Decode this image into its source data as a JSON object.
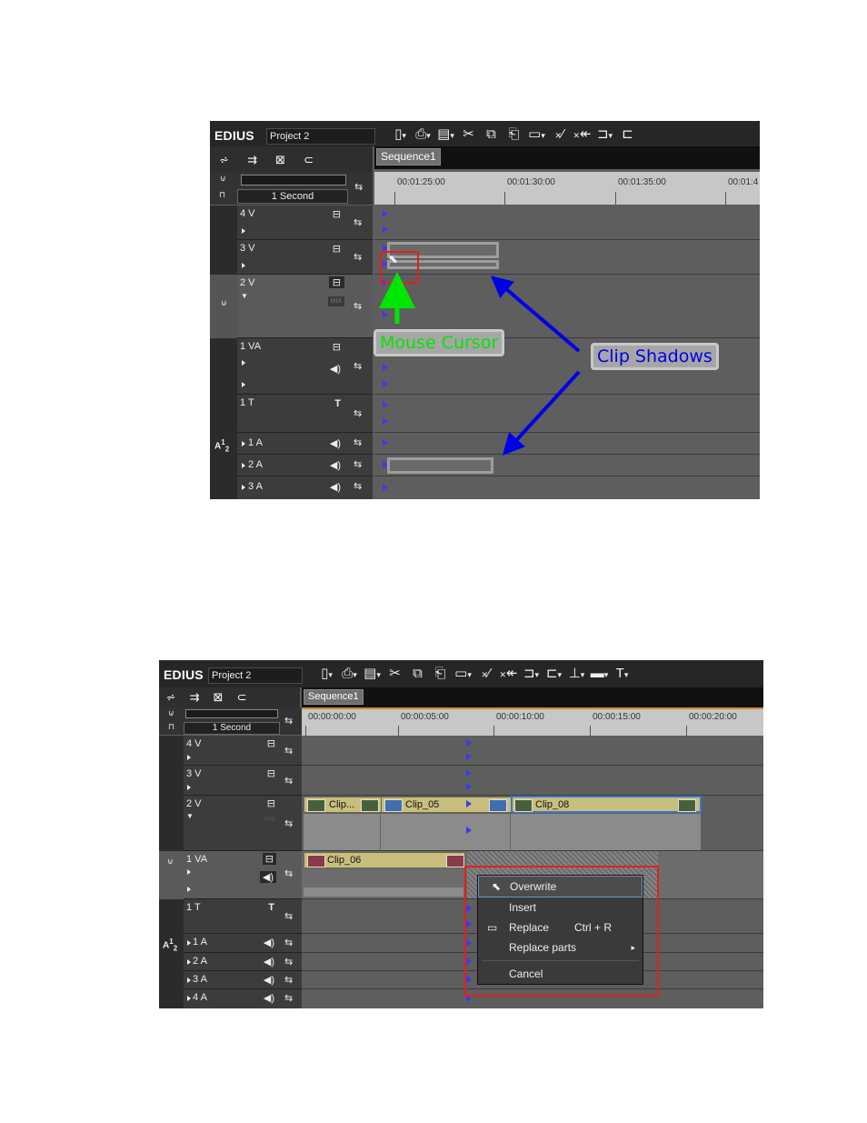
{
  "app": {
    "logo": "EDIUS",
    "project": "Project 2",
    "sequence_tab": "Sequence1",
    "zoom": "1 Second"
  },
  "colors": {
    "accent_blue_arrow": "#0000e6",
    "cursor_green": "#00e600",
    "highlight_red": "#e02020"
  },
  "toolbar_icons": [
    "new-project-icon",
    "open-project-icon",
    "save-icon",
    "cut-icon",
    "copy-icon",
    "paste-icon",
    "ripple-mode-icon",
    "delete-icon",
    "ripple-delete-icon",
    "undo-icon",
    "redo-icon",
    "mark-in-out-icon",
    "title-icon"
  ],
  "screen1": {
    "ruler": [
      "00:01:25:00",
      "00:01:30:00",
      "00:01:35:00",
      "00:01:4"
    ],
    "tracks": [
      {
        "name": "4 V"
      },
      {
        "name": "3 V"
      },
      {
        "name": "2 V",
        "mix": "MIX"
      },
      {
        "name": "1 VA"
      },
      {
        "name": "1 T",
        "icon": "T"
      },
      {
        "name": "1 A"
      },
      {
        "name": "2 A"
      },
      {
        "name": "3 A"
      }
    ],
    "annotations": {
      "mouse_cursor": "Mouse Cursor",
      "clip_shadows": "Clip Shadows"
    }
  },
  "screen2": {
    "ruler": [
      "00:00:00:00",
      "00:00:05:00",
      "00:00:10:00",
      "00:00:15:00",
      "00:00:20:00"
    ],
    "tracks": [
      {
        "name": "4 V"
      },
      {
        "name": "3 V"
      },
      {
        "name": "2 V",
        "mix": "MIX"
      },
      {
        "name": "1 VA"
      },
      {
        "name": "1 T",
        "icon": "T"
      },
      {
        "name": "1 A"
      },
      {
        "name": "2 A"
      },
      {
        "name": "3 A"
      },
      {
        "name": "4 A"
      }
    ],
    "clips": {
      "c1": "Clip...",
      "c2": "Clip_05",
      "c3": "Clip_08",
      "c4": "Clip_06"
    },
    "context_menu": {
      "overwrite": "Overwrite",
      "insert": "Insert",
      "replace": "Replace",
      "replace_shortcut": "Ctrl + R",
      "replace_parts": "Replace parts",
      "cancel": "Cancel"
    }
  },
  "track_patch_label": {
    "a_main": "A",
    "a_num_top": "1",
    "a_num_bottom": "2"
  }
}
